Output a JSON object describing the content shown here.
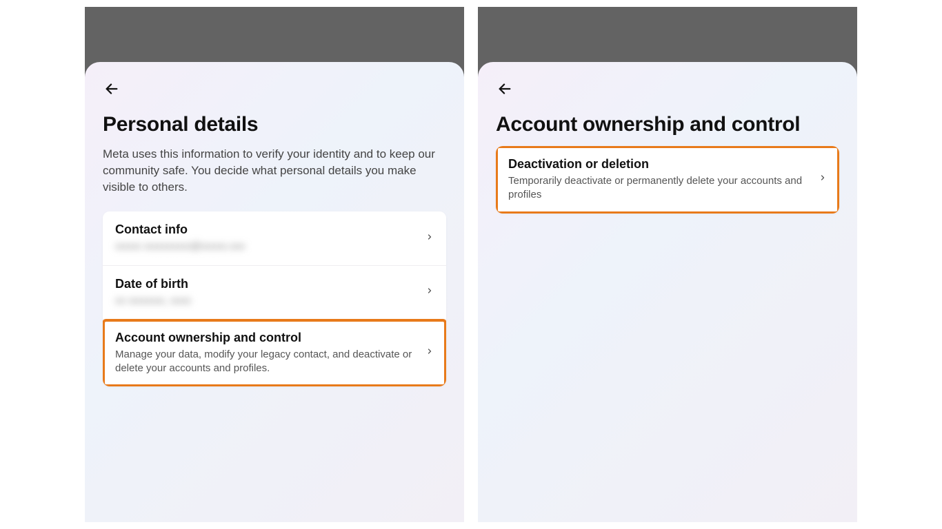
{
  "left": {
    "title": "Personal details",
    "description": "Meta uses this information to verify your identity and to keep our community safe. You decide what personal details you make visible to others.",
    "items": [
      {
        "title": "Contact info",
        "sub_blurred": "xxxxx xxxxxxxxx@xxxxx.xxx"
      },
      {
        "title": "Date of birth",
        "sub_blurred": "xx xxxxxxx, xxxx"
      },
      {
        "title": "Account ownership and control",
        "sub": "Manage your data, modify your legacy contact, and deactivate or delete your accounts and profiles."
      }
    ]
  },
  "right": {
    "title": "Account ownership and control",
    "item": {
      "title": "Deactivation or deletion",
      "sub": "Temporarily deactivate or permanently delete your accounts and profiles"
    }
  }
}
